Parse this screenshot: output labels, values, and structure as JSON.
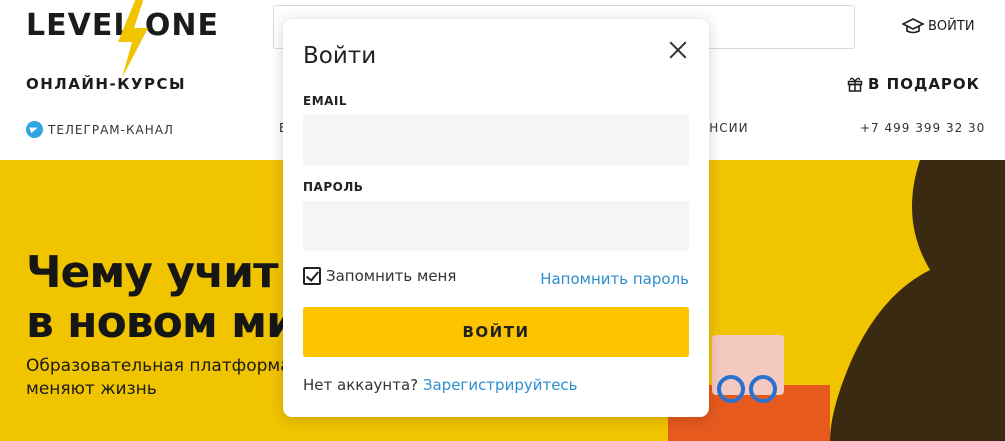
{
  "header": {
    "logo_text": "LEVEL ONE",
    "login_label": "ВОЙТИ",
    "nav_courses": "ОНЛАЙН-КУРСЫ",
    "nav_gift": "В ПОДАРОК",
    "telegram": "ТЕЛЕГРАМ-КАНАЛ",
    "sub_b": "Б",
    "vacancies": "АНСИИ",
    "phone": "+7 499 399 32 30"
  },
  "hero": {
    "title": "Чему учит\nв новом ми",
    "subtitle": "Образовательная платформа\nменяют жизнь"
  },
  "modal": {
    "title": "Войти",
    "email_label": "EMAIL",
    "email_value": "",
    "password_label": "ПАРОЛЬ",
    "password_value": "",
    "remember_label": "Запомнить меня",
    "remember_checked": true,
    "forgot_label": "Напомнить пароль",
    "submit_label": "ВОЙТИ",
    "no_account_text": "Нет аккаунта? ",
    "register_label": "Зарегистрируйтесь"
  },
  "colors": {
    "accent_yellow": "#ffc400",
    "hero_yellow": "#f1c400",
    "link_blue": "#2b8ecf",
    "telegram_blue": "#2ea6df"
  },
  "icons": {
    "close": "close-icon",
    "graduation": "graduation-cap-icon",
    "gift": "gift-icon",
    "telegram": "telegram-icon",
    "checkbox": "checkmark-icon",
    "logo_bolt": "lightning-bolt-icon"
  }
}
